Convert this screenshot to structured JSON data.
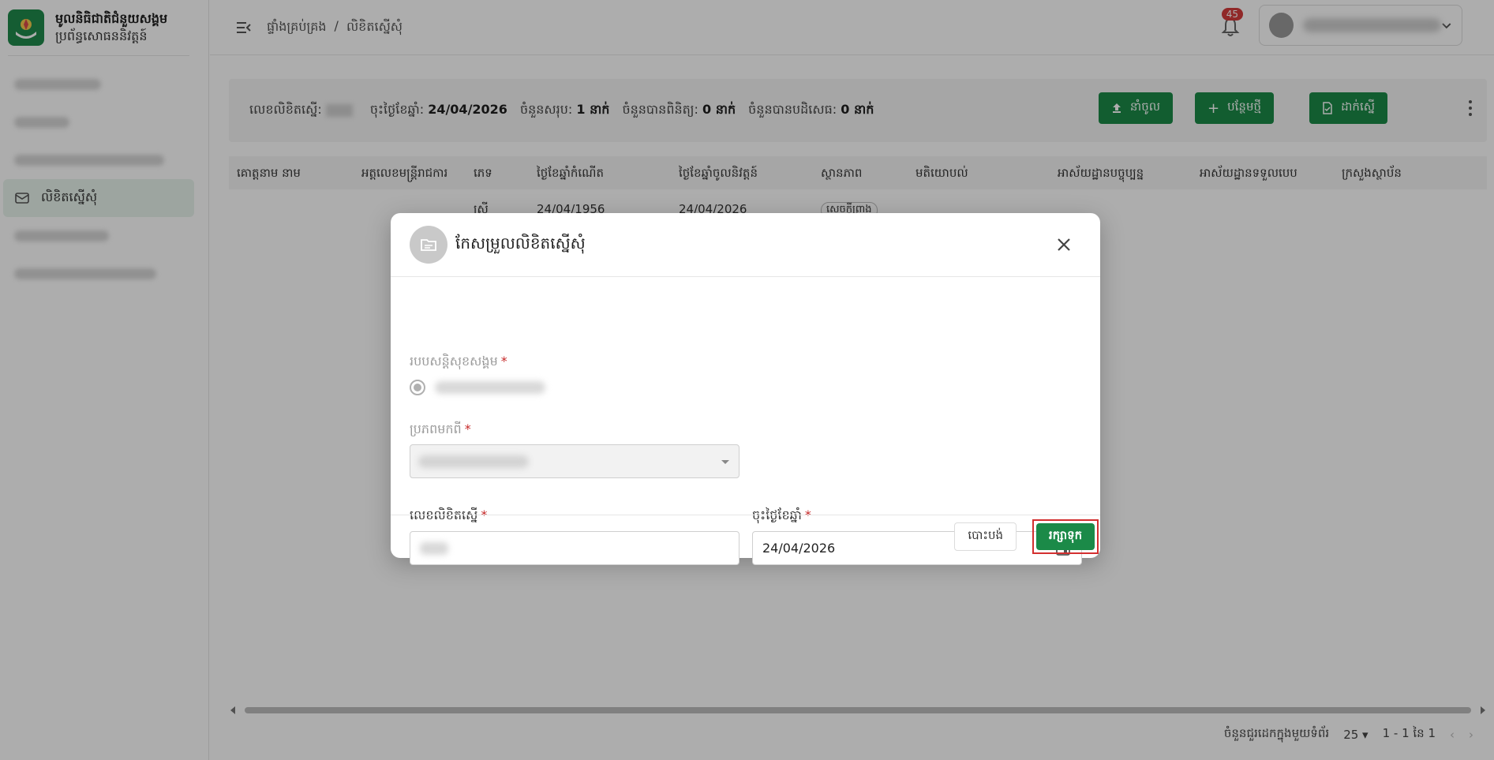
{
  "sidebar": {
    "brand_title": "មូលនិធិជាតិជំនួយសង្គម",
    "brand_subtitle": "ប្រព័ន្ធសោធននិវត្តន៍",
    "active_item_label": "លិខិតស្នើសុំ"
  },
  "header": {
    "breadcrumb": [
      "ផ្ទាំងគ្រប់គ្រង",
      "/",
      "លិខិតស្នើសុំ"
    ],
    "notification_count": "45"
  },
  "summary": {
    "request_no_label": "លេខលិខិតស្នើ:",
    "date_label": "ចុះថ្ងៃខែឆ្នាំ:",
    "date_value": "24/04/2026",
    "total_label": "ចំនួនសរុប:",
    "total_value": "1 នាក់",
    "verified_label": "ចំនួនបានពិនិត្យ:",
    "verified_value": "0 នាក់",
    "rejected_label": "ចំនួនបានបដិសេធ:",
    "rejected_value": "0 នាក់",
    "import_label": "នាំចូល",
    "add_label": "បន្ថែមថ្មី",
    "submit_label": "ដាក់ស្នើ"
  },
  "table": {
    "columns": [
      "គោត្តនាម នាម",
      "អត្តលេខមន្ត្រីរាជការ",
      "ភេទ",
      "ថ្ងៃខែឆ្នាំកំណើត",
      "ថ្ងៃខែឆ្នាំចូលនិវត្តន៍",
      "ស្ថានភាព",
      "មតិយោបល់",
      "អាស័យដ្ឋានបច្ចុប្បន្ន",
      "អាស័យដ្ឋានទទួលបេប",
      "ក្រសួងស្ថាប័ន"
    ],
    "row": {
      "gender": "ស្រី",
      "dob": "24/04/1956",
      "retire_date": "24/04/2026",
      "status": "សេចក្តីព្រាង"
    }
  },
  "footer": {
    "rows_per_page_label": "ចំនួនជួរដេកក្នុងមួយទំព័រ",
    "rows_per_page_value": "25",
    "range": "1 - 1 នៃ 1"
  },
  "modal": {
    "title": "កែសម្រួលលិខិតស្នើសុំ",
    "social_scheme_label": "របបសន្តិសុខសង្គម",
    "source_label": "ប្រភពមកពី",
    "request_no_label": "លេខលិខិតស្នើ",
    "date_label": "ចុះថ្ងៃខែឆ្នាំ",
    "date_value": "24/04/2026",
    "required_mark": "*",
    "cancel_label": "បោះបង់",
    "save_label": "រក្សាទុក"
  },
  "colors": {
    "primary": "#1b8a48",
    "danger": "#d32f2f"
  }
}
